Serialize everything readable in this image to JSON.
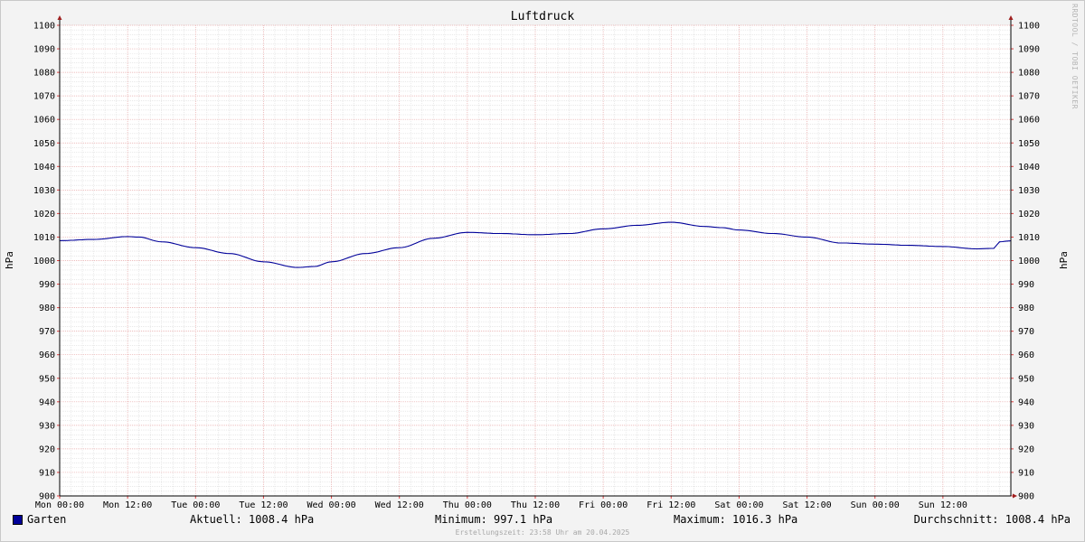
{
  "chart_data": {
    "type": "line",
    "title": "Luftdruck",
    "ylabel": "hPa",
    "ylabel_right": "hPa",
    "ylim": [
      900,
      1100
    ],
    "yticks": [
      900,
      910,
      920,
      930,
      940,
      950,
      960,
      970,
      980,
      990,
      1000,
      1010,
      1020,
      1030,
      1040,
      1050,
      1060,
      1070,
      1080,
      1090,
      1100
    ],
    "xlabels": [
      "Mon 00:00",
      "Mon 12:00",
      "Tue 00:00",
      "Tue 12:00",
      "Wed 00:00",
      "Wed 12:00",
      "Thu 00:00",
      "Thu 12:00",
      "Fri 00:00",
      "Fri 12:00",
      "Sat 00:00",
      "Sat 12:00",
      "Sun 00:00",
      "Sun 12:00"
    ],
    "grid": true,
    "series": [
      {
        "name": "Garten",
        "color": "#000099",
        "x_hours": [
          0,
          6,
          12,
          14,
          18,
          24,
          30,
          36,
          42,
          45,
          48,
          54,
          60,
          66,
          72,
          78,
          84,
          90,
          96,
          102,
          108,
          114,
          117,
          120,
          126,
          132,
          138,
          144,
          150,
          156,
          162,
          165,
          166,
          168
        ],
        "values": [
          1008.5,
          1009.0,
          1010.2,
          1010.0,
          1008.0,
          1005.5,
          1003.0,
          999.5,
          997.1,
          997.5,
          999.5,
          1003.0,
          1005.5,
          1009.5,
          1012.0,
          1011.5,
          1011.0,
          1011.5,
          1013.5,
          1015.0,
          1016.3,
          1014.5,
          1014.0,
          1013.0,
          1011.5,
          1010.0,
          1007.5,
          1007.0,
          1006.5,
          1006.0,
          1005.0,
          1005.2,
          1008.0,
          1008.4
        ]
      }
    ]
  },
  "legend": {
    "series_name": "Garten",
    "current": "Aktuell: 1008.4 hPa",
    "minimum": "Minimum: 997.1 hPa",
    "maximum": "Maximum: 1016.3 hPa",
    "average": "Durchschnitt: 1008.4 hPa"
  },
  "footer": "Erstellungszeit: 23:58 Uhr am 20.04.2025",
  "watermark": "RRDTOOL / TOBI OETIKER"
}
